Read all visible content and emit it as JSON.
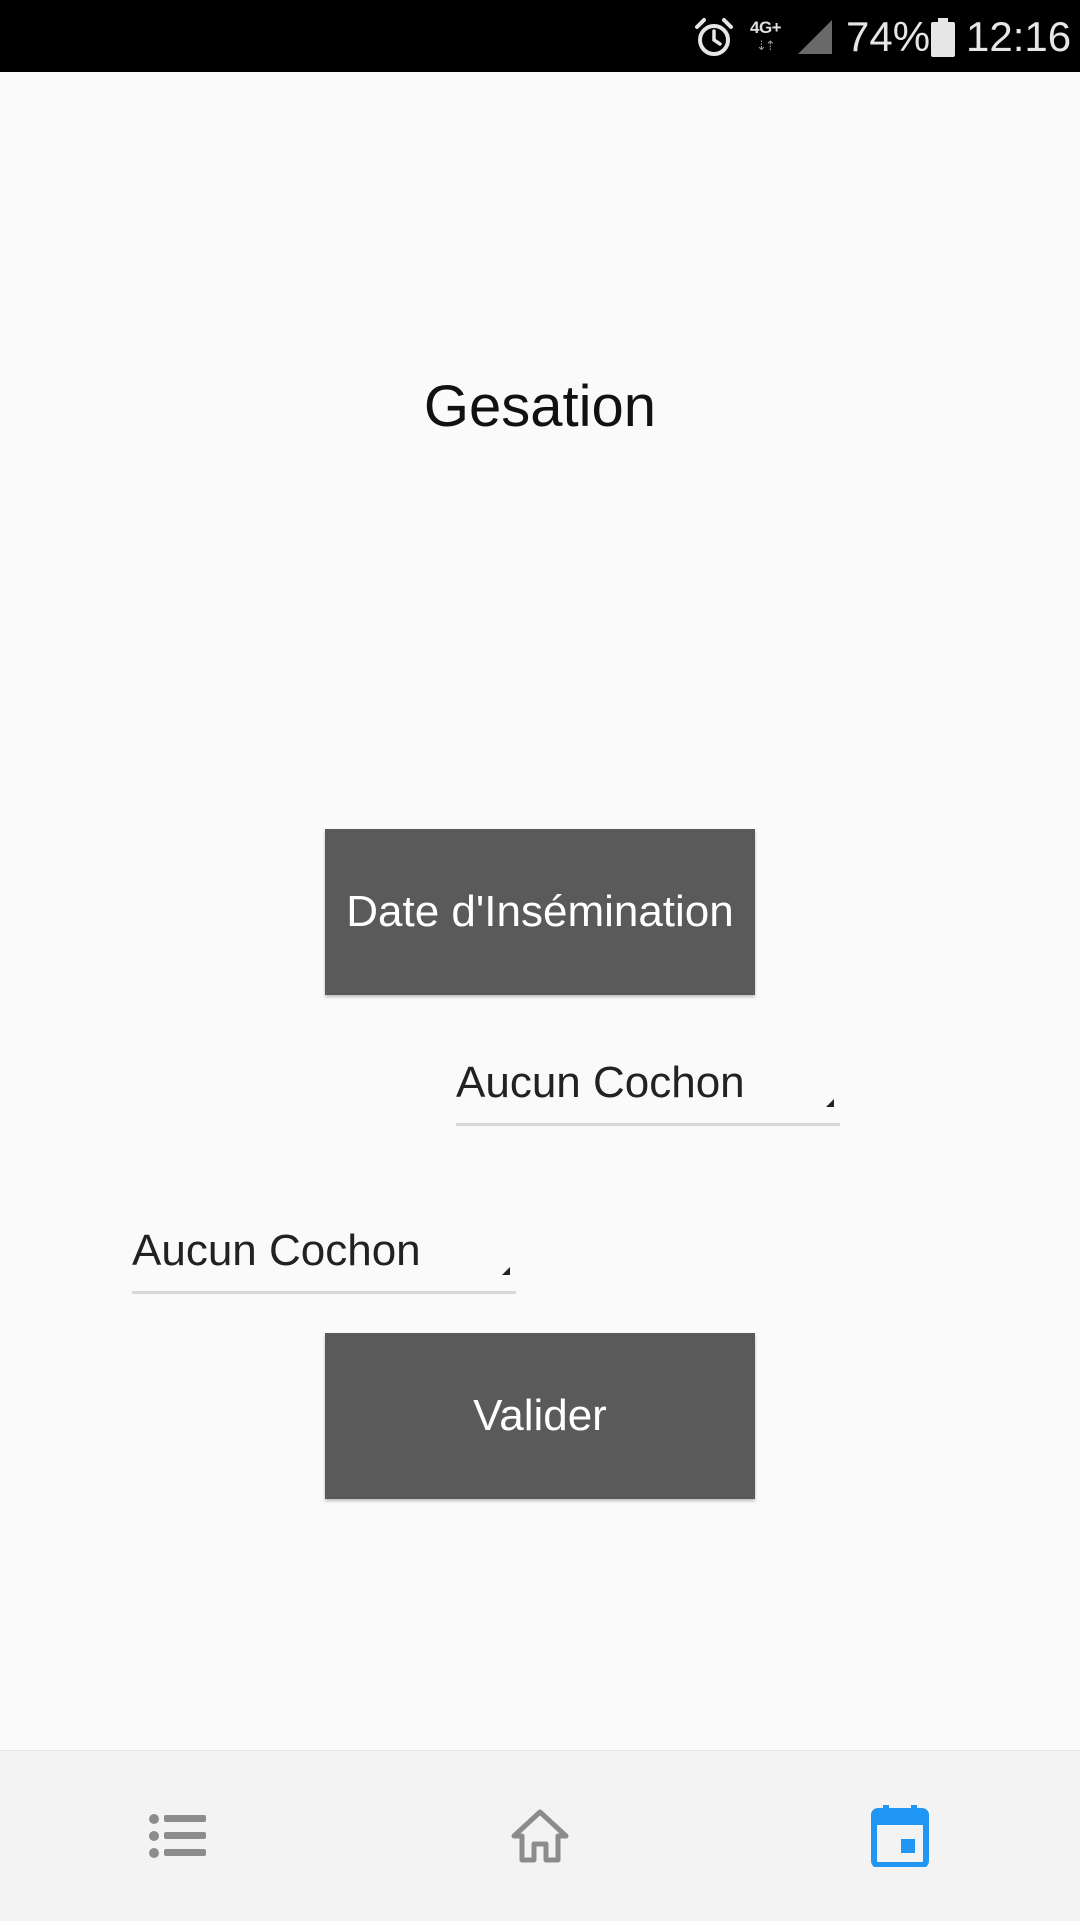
{
  "status_bar": {
    "network_label": "4G+",
    "battery_percent": "74%",
    "time": "12:16",
    "icons": [
      "alarm-icon",
      "network-4g-icon",
      "signal-icon",
      "battery-icon"
    ]
  },
  "page": {
    "title": "Gesation"
  },
  "buttons": {
    "date_label": "Date d'Insémination",
    "submit_label": "Valider"
  },
  "spinners": [
    {
      "value": "Aucun Cochon"
    },
    {
      "value": "Aucun Cochon"
    }
  ],
  "bottom_nav": {
    "items": [
      {
        "icon": "list-icon",
        "color": "#8c8c8c",
        "selected": false
      },
      {
        "icon": "home-icon",
        "color": "#8c8c8c",
        "selected": false
      },
      {
        "icon": "calendar-icon",
        "color": "#2196f3",
        "selected": true
      }
    ]
  },
  "colors": {
    "button_bg": "#5a5a5a",
    "accent": "#2196f3",
    "background": "#fafafa"
  }
}
